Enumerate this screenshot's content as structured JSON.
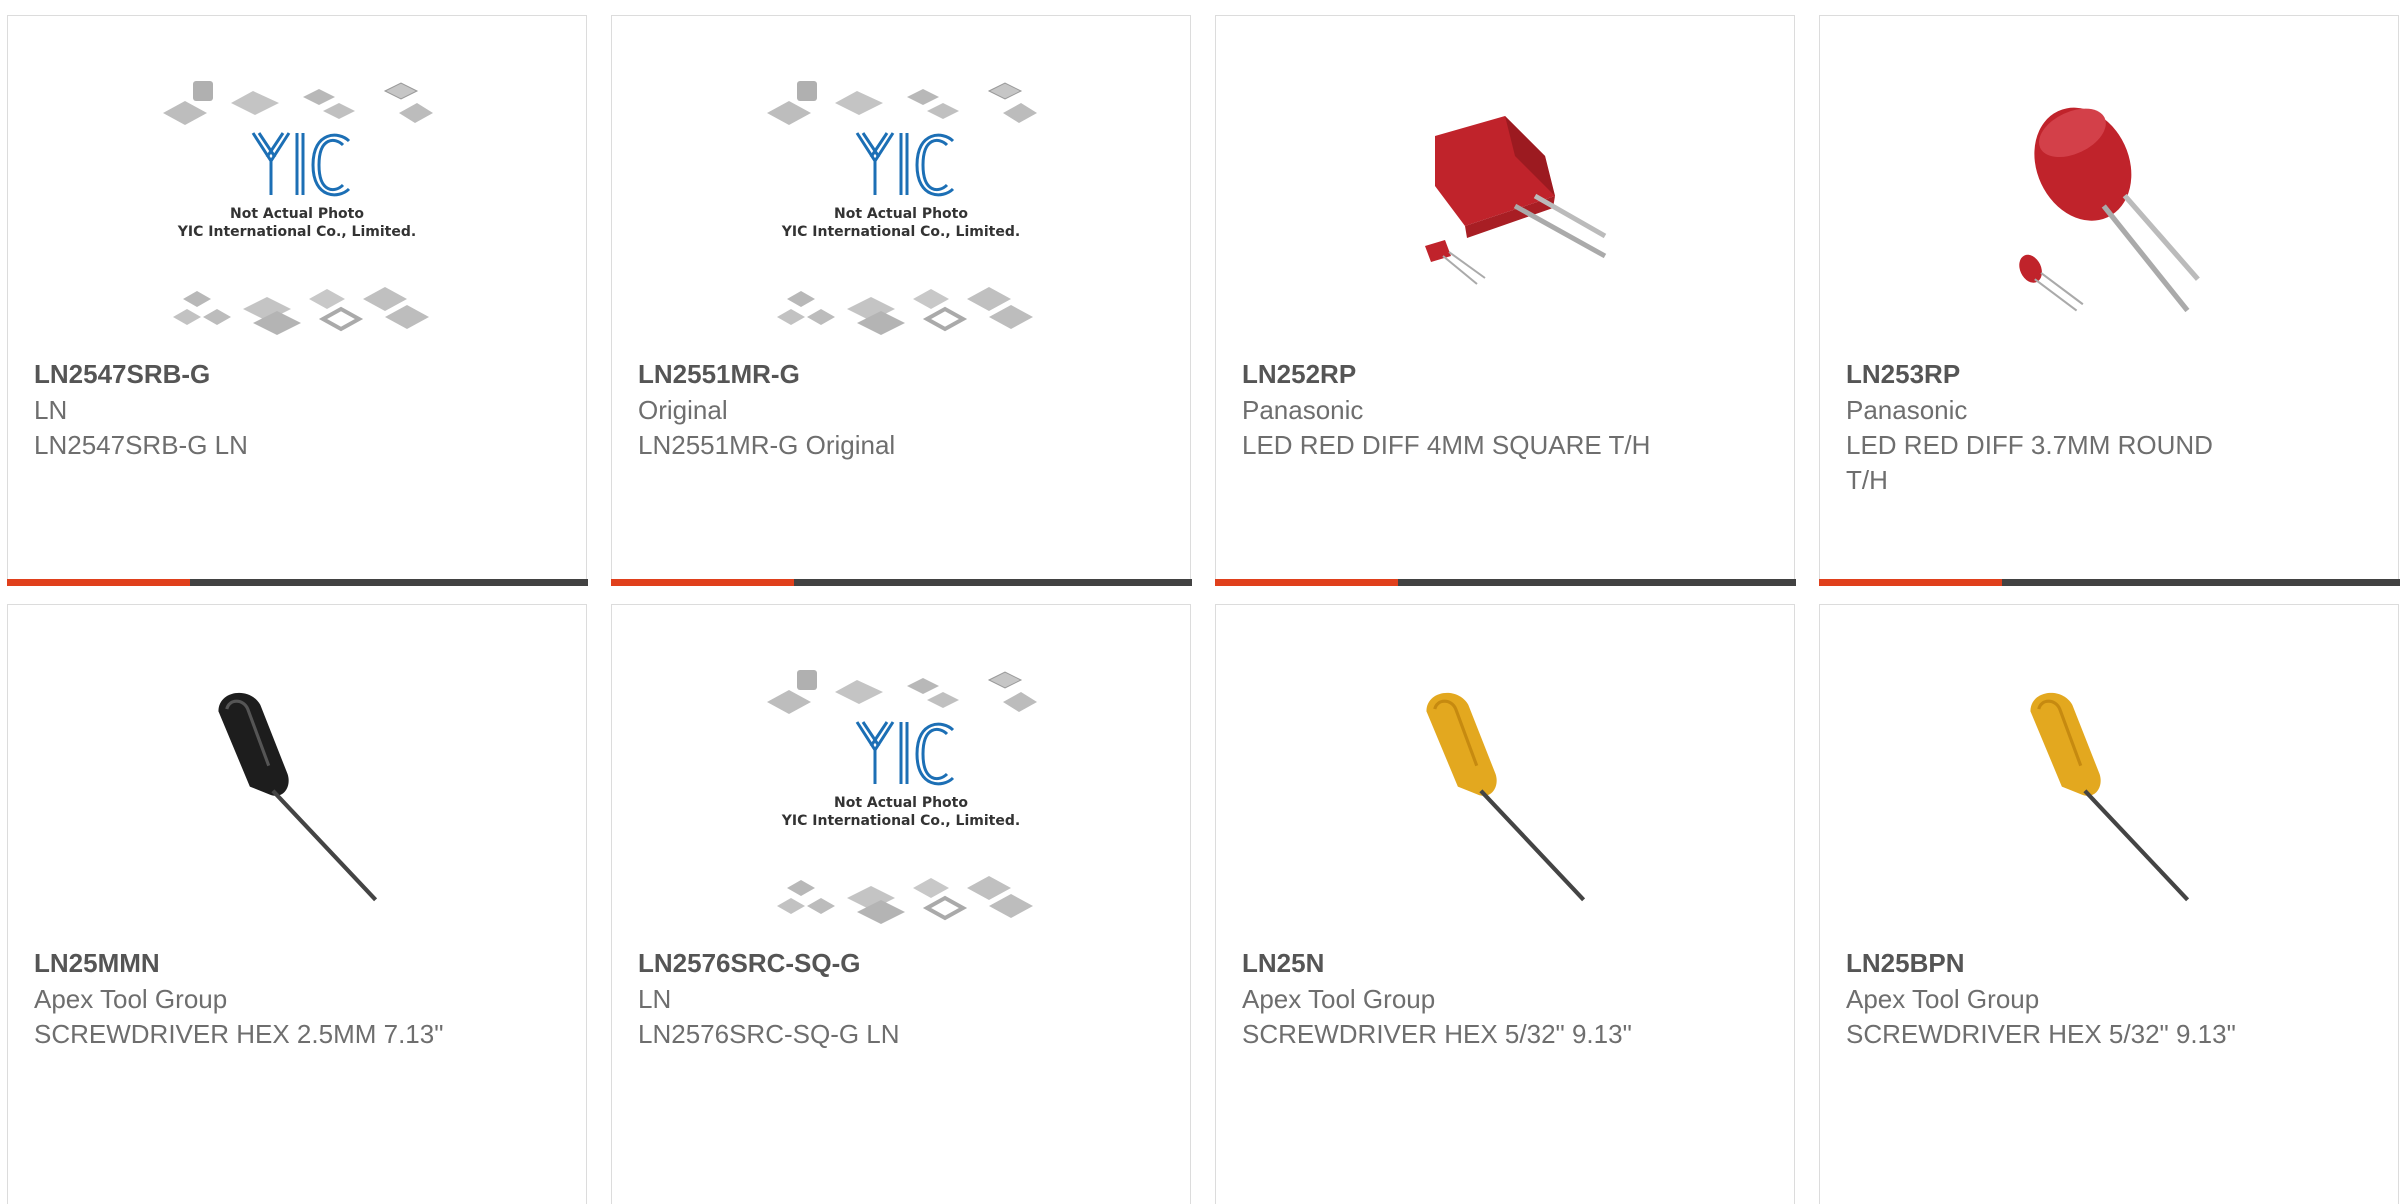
{
  "colors": {
    "accent": "#e0401c",
    "bar": "#424242",
    "border": "#dcdcdc",
    "text": "#6e6e6e",
    "logo_blue": "#1c6fb5"
  },
  "placeholder": {
    "line1": "Not Actual Photo",
    "line2": "YIC International Co., Limited.",
    "logo": "YIC"
  },
  "products": [
    {
      "part_number": "LN2547SRB-G",
      "manufacturer": "LN",
      "description": "LN2547SRB-G LN",
      "image": "not-actual-photo"
    },
    {
      "part_number": "LN2551MR-G",
      "manufacturer": "Original",
      "description": "LN2551MR-G Original",
      "image": "not-actual-photo"
    },
    {
      "part_number": "LN252RP",
      "manufacturer": "Panasonic",
      "description": "LED RED DIFF 4MM SQUARE T/H",
      "image": "led-square-red"
    },
    {
      "part_number": "LN253RP",
      "manufacturer": "Panasonic",
      "description": "LED RED DIFF 3.7MM ROUND T/H",
      "image": "led-round-red"
    },
    {
      "part_number": "LN25MMN",
      "manufacturer": "Apex Tool Group",
      "description": "SCREWDRIVER HEX 2.5MM 7.13\"",
      "image": "screwdriver-black"
    },
    {
      "part_number": "LN2576SRC-SQ-G",
      "manufacturer": "LN",
      "description": "LN2576SRC-SQ-G LN",
      "image": "not-actual-photo"
    },
    {
      "part_number": "LN25N",
      "manufacturer": "Apex Tool Group",
      "description": "SCREWDRIVER HEX 5/32\" 9.13\"",
      "image": "screwdriver-yellow"
    },
    {
      "part_number": "LN25BPN",
      "manufacturer": "Apex Tool Group",
      "description": "SCREWDRIVER HEX 5/32\" 9.13\"",
      "image": "screwdriver-yellow"
    }
  ]
}
